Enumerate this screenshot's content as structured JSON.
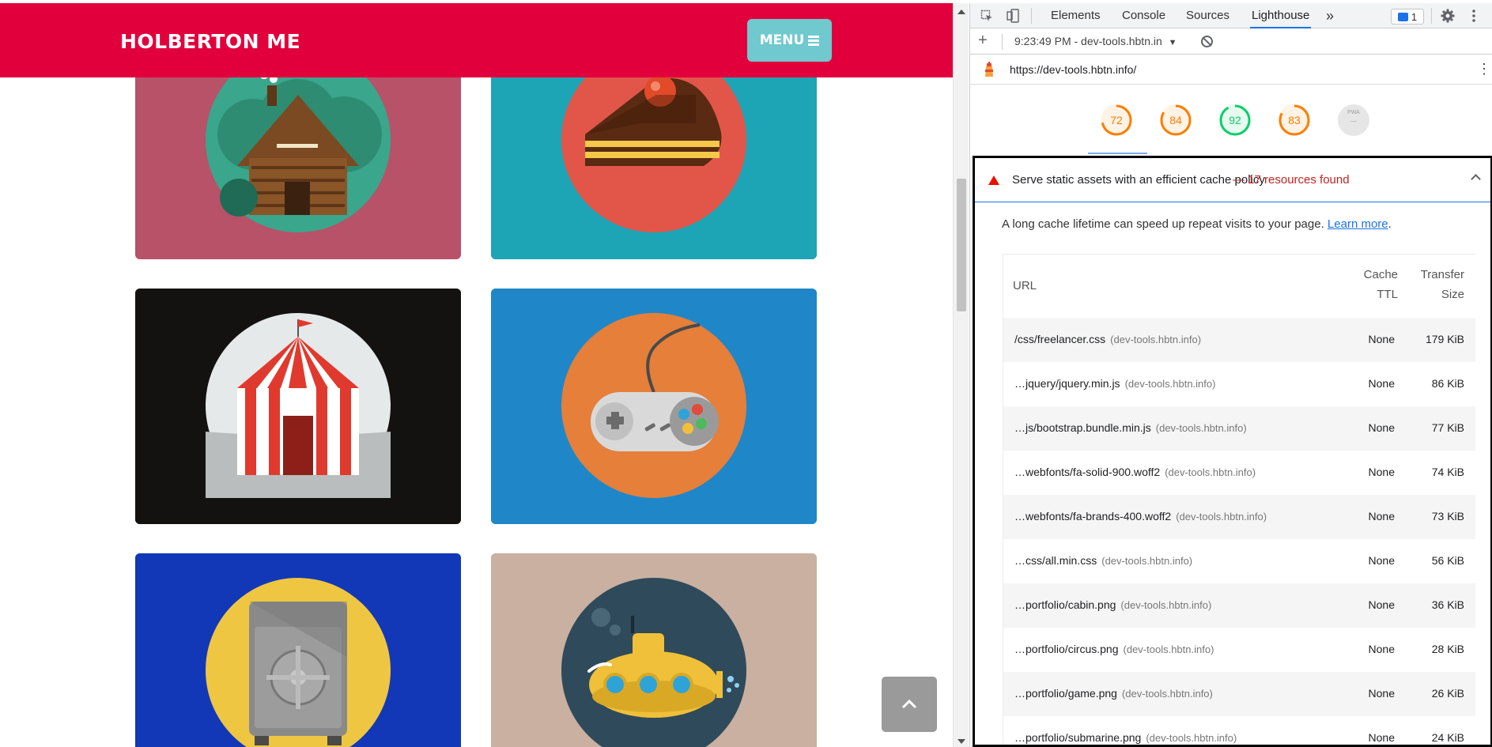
{
  "site": {
    "brand": "HOLBERTON ME",
    "menu_label": "MENU",
    "tiles": [
      {
        "name": "cabin",
        "bg": "#b85268",
        "disc": "#3aa68c"
      },
      {
        "name": "cake",
        "bg": "#1da5b5",
        "disc": "#e2564a"
      },
      {
        "name": "circus",
        "bg": "#141111",
        "disc": "#e6e9e9"
      },
      {
        "name": "game",
        "bg": "#1f87c8",
        "disc": "#e57f3a"
      },
      {
        "name": "safe",
        "bg": "#1238b8",
        "disc": "#eec642"
      },
      {
        "name": "submarine",
        "bg": "#c9b0a0",
        "disc": "#2f4a5a"
      }
    ],
    "colors": {
      "nav": "#e2003c",
      "menu_button": "#6fc9cf"
    }
  },
  "devtools": {
    "tabs": [
      {
        "label": "Elements",
        "active": false
      },
      {
        "label": "Console",
        "active": false
      },
      {
        "label": "Sources",
        "active": false
      },
      {
        "label": "Lighthouse",
        "active": true
      }
    ],
    "more_tabs": "»",
    "issues_count": "1",
    "report_selector": "9:23:49 PM - dev-tools.hbtn.in",
    "url": "https://dev-tools.hbtn.info/",
    "scores": [
      {
        "value": "72",
        "color": "#fa7e00",
        "bg": "#fff3e6",
        "fraction": 0.72
      },
      {
        "value": "84",
        "color": "#fa7e00",
        "bg": "#fff3e6",
        "fraction": 0.84
      },
      {
        "value": "92",
        "color": "#0cce6b",
        "bg": "#e8fbf0",
        "fraction": 0.92
      },
      {
        "value": "83",
        "color": "#fa7e00",
        "bg": "#fff3e6",
        "fraction": 0.83
      },
      {
        "value": "–",
        "color": "#bdbdbd",
        "bg": "#e6e6e6",
        "fraction": 0,
        "small": "PWA"
      }
    ],
    "audit": {
      "title": "Serve static assets with an efficient cache policy",
      "found": "— 17 resources found",
      "description": "A long cache lifetime can speed up repeat visits to your page.",
      "learn_more": "Learn more",
      "desc_tail": ".",
      "columns": {
        "url": "URL",
        "ttl_1": "Cache",
        "ttl_2": "TTL",
        "size_1": "Transfer",
        "size_2": "Size"
      },
      "rows": [
        {
          "url": "/css/freelancer.css",
          "host": "(dev-tools.hbtn.info)",
          "ttl": "None",
          "size": "179 KiB"
        },
        {
          "url": "…jquery/jquery.min.js",
          "host": "(dev-tools.hbtn.info)",
          "ttl": "None",
          "size": "86 KiB"
        },
        {
          "url": "…js/bootstrap.bundle.min.js",
          "host": "(dev-tools.hbtn.info)",
          "ttl": "None",
          "size": "77 KiB"
        },
        {
          "url": "…webfonts/fa-solid-900.woff2",
          "host": "(dev-tools.hbtn.info)",
          "ttl": "None",
          "size": "74 KiB"
        },
        {
          "url": "…webfonts/fa-brands-400.woff2",
          "host": "(dev-tools.hbtn.info)",
          "ttl": "None",
          "size": "73 KiB"
        },
        {
          "url": "…css/all.min.css",
          "host": "(dev-tools.hbtn.info)",
          "ttl": "None",
          "size": "56 KiB"
        },
        {
          "url": "…portfolio/cabin.png",
          "host": "(dev-tools.hbtn.info)",
          "ttl": "None",
          "size": "36 KiB"
        },
        {
          "url": "…portfolio/circus.png",
          "host": "(dev-tools.hbtn.info)",
          "ttl": "None",
          "size": "28 KiB"
        },
        {
          "url": "…portfolio/game.png",
          "host": "(dev-tools.hbtn.info)",
          "ttl": "None",
          "size": "26 KiB"
        },
        {
          "url": "…portfolio/submarine.png",
          "host": "(dev-tools.hbtn.info)",
          "ttl": "None",
          "size": "24 KiB"
        }
      ]
    }
  }
}
